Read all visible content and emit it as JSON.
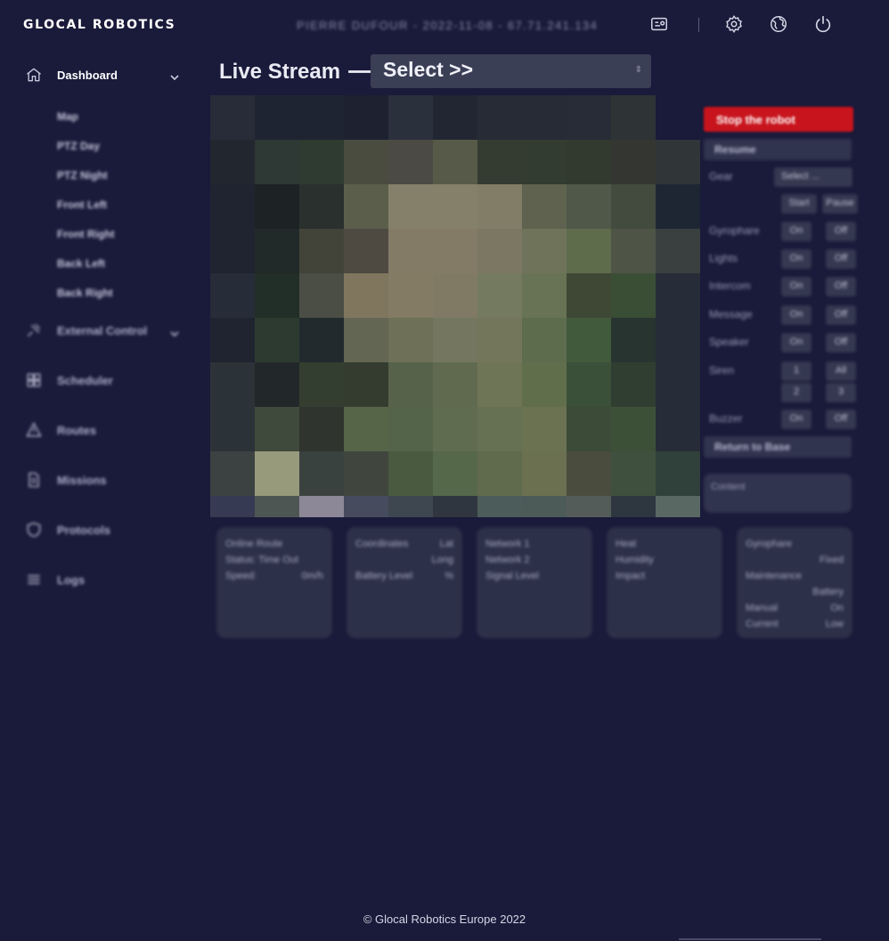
{
  "app": {
    "logo_text": "GLOCAL ROBOTICS",
    "user_info": "PIERRE DUFOUR - 2022-11-08 - 67.71.241.134",
    "icons": [
      "id-card-icon",
      "gear-icon",
      "globe-icon",
      "power-icon"
    ]
  },
  "sidebar": {
    "dashboard": {
      "label": "Dashboard",
      "icon": "home-icon"
    },
    "sub_items": [
      "Map",
      "PTZ Day",
      "PTZ Night",
      "Front Left",
      "Front Right",
      "Back Left",
      "Back Right"
    ],
    "items": [
      {
        "label": "External Control",
        "icon": "satellite-icon"
      },
      {
        "label": "Scheduler",
        "icon": "grid-icon"
      },
      {
        "label": "Routes",
        "icon": "route-icon"
      },
      {
        "label": "Missions",
        "icon": "document-icon"
      },
      {
        "label": "Protocols",
        "icon": "shield-icon"
      },
      {
        "label": "Logs",
        "icon": "list-icon"
      }
    ]
  },
  "stream": {
    "title": "Live Stream",
    "arrow": "⟶",
    "select_value": "Select >>"
  },
  "control": {
    "stop_label": "Stop the robot",
    "resume_label": "Resume",
    "gear_label": "Gear",
    "gear_value": "Select ...",
    "start_label": "Start",
    "pause_label": "Pause",
    "rows": [
      {
        "label": "Gyrophare",
        "on": "On",
        "off": "Off"
      },
      {
        "label": "Lights",
        "on": "On",
        "off": "Off"
      },
      {
        "label": "Intercom",
        "on": "On",
        "off": "Off"
      },
      {
        "label": "Message",
        "on": "On",
        "off": "Off"
      },
      {
        "label": "Speaker",
        "on": "On",
        "off": "Off"
      }
    ],
    "siren_label": "Siren",
    "siren_buttons": [
      "1",
      "All",
      "2",
      "3"
    ],
    "buzzer": {
      "label": "Buzzer",
      "on": "On",
      "off": "Off"
    },
    "return_label": "Return to Base",
    "content_label": "Content"
  },
  "info_cards": [
    {
      "rows": [
        [
          "Online Route",
          ""
        ],
        [
          "Status: Time Out",
          ""
        ],
        [
          "Speed:",
          "0m/h"
        ]
      ]
    },
    {
      "rows": [
        [
          "Coordinates",
          "Lat"
        ],
        [
          "",
          "Long"
        ],
        [
          "Battery Level",
          "%"
        ]
      ]
    },
    {
      "rows": [
        [
          "Network 1",
          ""
        ],
        [
          "Network 2",
          ""
        ],
        [
          "Signal Level",
          ""
        ]
      ]
    },
    {
      "rows": [
        [
          "Heat",
          ""
        ],
        [
          "Humidity",
          ""
        ],
        [
          "Impact",
          ""
        ]
      ]
    },
    {
      "rows": [
        [
          "Gyrophare",
          ""
        ],
        [
          "",
          "Fixed"
        ],
        [
          "Maintenance",
          ""
        ],
        [
          "",
          "Battery"
        ],
        [
          "Manual",
          "On"
        ],
        [
          "Current",
          "Low"
        ]
      ]
    }
  ],
  "footer": {
    "copyright": "© Glocal Robotics Europe 2022"
  },
  "colors": {
    "background": "#1a1a3a",
    "stop_button": "#c8141c",
    "select_bg": "#3a3f56",
    "panel_bg": "#2c3048"
  }
}
